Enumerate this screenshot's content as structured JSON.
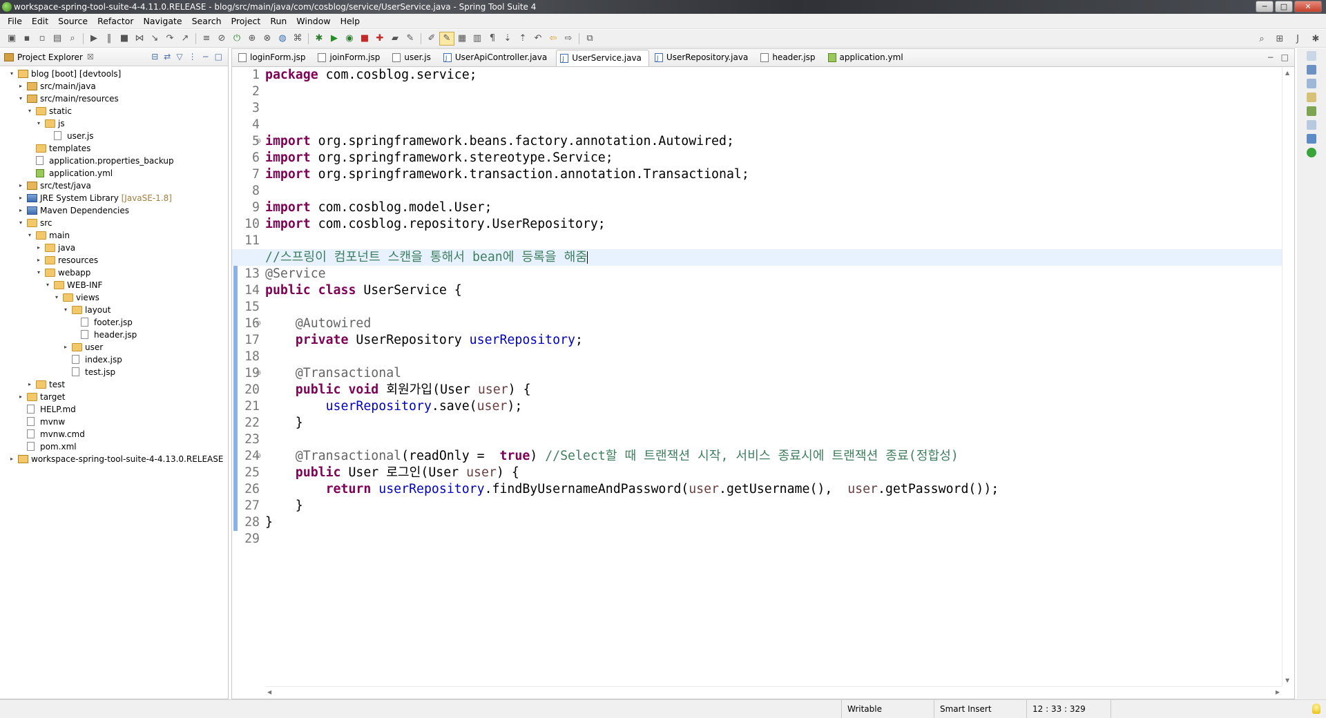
{
  "window": {
    "title": "workspace-spring-tool-suite-4-4.11.0.RELEASE - blog/src/main/java/com/cosblog/service/UserService.java - Spring Tool Suite 4",
    "controls": [
      "─",
      "□",
      "✕"
    ]
  },
  "menu": [
    "File",
    "Edit",
    "Source",
    "Refactor",
    "Navigate",
    "Search",
    "Project",
    "Run",
    "Window",
    "Help"
  ],
  "explorer": {
    "title": "Project Explorer",
    "close": "☒",
    "tree": [
      {
        "label": "blog [boot] [devtools]",
        "icon": "project-icon",
        "depth": 0,
        "twisty": "▾"
      },
      {
        "label": "src/main/java",
        "icon": "source-folder-icon",
        "depth": 1,
        "twisty": "▸"
      },
      {
        "label": "src/main/resources",
        "icon": "source-folder-icon",
        "depth": 1,
        "twisty": "▾"
      },
      {
        "label": "static",
        "icon": "folder-icon",
        "depth": 2,
        "twisty": "▾"
      },
      {
        "label": "js",
        "icon": "folder-icon",
        "depth": 3,
        "twisty": "▾"
      },
      {
        "label": "user.js",
        "icon": "file-icon",
        "depth": 4,
        "twisty": ""
      },
      {
        "label": "templates",
        "icon": "folder-icon",
        "depth": 2,
        "twisty": ""
      },
      {
        "label": "application.properties_backup",
        "icon": "file-icon",
        "depth": 2,
        "twisty": ""
      },
      {
        "label": "application.yml",
        "icon": "yml-file-icon",
        "depth": 2,
        "twisty": ""
      },
      {
        "label": "src/test/java",
        "icon": "source-folder-icon",
        "depth": 1,
        "twisty": "▸"
      },
      {
        "label": "JRE System Library",
        "suffix": "[JavaSE-1.8]",
        "icon": "library-icon",
        "depth": 1,
        "twisty": "▸"
      },
      {
        "label": "Maven Dependencies",
        "icon": "library-icon",
        "depth": 1,
        "twisty": "▸"
      },
      {
        "label": "src",
        "icon": "folder-icon",
        "depth": 1,
        "twisty": "▾"
      },
      {
        "label": "main",
        "icon": "folder-icon",
        "depth": 2,
        "twisty": "▾"
      },
      {
        "label": "java",
        "icon": "folder-icon",
        "depth": 3,
        "twisty": "▸"
      },
      {
        "label": "resources",
        "icon": "folder-icon",
        "depth": 3,
        "twisty": "▸"
      },
      {
        "label": "webapp",
        "icon": "folder-icon",
        "depth": 3,
        "twisty": "▾"
      },
      {
        "label": "WEB-INF",
        "icon": "folder-icon",
        "depth": 4,
        "twisty": "▾"
      },
      {
        "label": "views",
        "icon": "folder-icon",
        "depth": 5,
        "twisty": "▾"
      },
      {
        "label": "layout",
        "icon": "folder-icon",
        "depth": 6,
        "twisty": "▾"
      },
      {
        "label": "footer.jsp",
        "icon": "file-icon",
        "depth": 7,
        "twisty": ""
      },
      {
        "label": "header.jsp",
        "icon": "file-icon",
        "depth": 7,
        "twisty": ""
      },
      {
        "label": "user",
        "icon": "folder-icon",
        "depth": 6,
        "twisty": "▸"
      },
      {
        "label": "index.jsp",
        "icon": "file-icon",
        "depth": 6,
        "twisty": ""
      },
      {
        "label": "test.jsp",
        "icon": "file-icon",
        "depth": 6,
        "twisty": ""
      },
      {
        "label": "test",
        "icon": "folder-icon",
        "depth": 2,
        "twisty": "▸"
      },
      {
        "label": "target",
        "icon": "folder-icon",
        "depth": 1,
        "twisty": "▸"
      },
      {
        "label": "HELP.md",
        "icon": "file-icon",
        "depth": 1,
        "twisty": ""
      },
      {
        "label": "mvnw",
        "icon": "file-icon",
        "depth": 1,
        "twisty": ""
      },
      {
        "label": "mvnw.cmd",
        "icon": "file-icon",
        "depth": 1,
        "twisty": ""
      },
      {
        "label": "pom.xml",
        "icon": "file-icon",
        "depth": 1,
        "twisty": ""
      },
      {
        "label": "workspace-spring-tool-suite-4-4.13.0.RELEASE",
        "icon": "project-icon",
        "depth": 0,
        "twisty": "▸"
      }
    ]
  },
  "editor": {
    "tabs": [
      {
        "label": "loginForm.jsp",
        "icon": "jsp-file-icon",
        "active": false
      },
      {
        "label": "joinForm.jsp",
        "icon": "jsp-file-icon",
        "active": false
      },
      {
        "label": "user.js",
        "icon": "js-file-icon",
        "active": false
      },
      {
        "label": "UserApiController.java",
        "icon": "java-file-icon",
        "active": false
      },
      {
        "label": "UserService.java",
        "icon": "java-file-icon",
        "active": true
      },
      {
        "label": "UserRepository.java",
        "icon": "java-file-icon",
        "active": false
      },
      {
        "label": "header.jsp",
        "icon": "jsp-file-icon",
        "active": false
      },
      {
        "label": "application.yml",
        "icon": "yml-file-icon",
        "active": false
      }
    ],
    "current_line": 12,
    "fold_lines": [
      5,
      16,
      19,
      24
    ],
    "lines": [
      [
        [
          "kw",
          "package"
        ],
        [
          "",
          "com.cosblog.service;"
        ]
      ],
      [],
      [],
      [],
      [
        [
          "kw",
          "import"
        ],
        [
          "",
          "org.springframework.beans.factory.annotation.Autowired;"
        ]
      ],
      [
        [
          "kw",
          "import"
        ],
        [
          "",
          "org.springframework.stereotype.Service;"
        ]
      ],
      [
        [
          "kw",
          "import"
        ],
        [
          "",
          "org.springframework.transaction.annotation.Transactional;"
        ]
      ],
      [],
      [
        [
          "kw",
          "import"
        ],
        [
          "",
          "com.cosblog.model.User;"
        ]
      ],
      [
        [
          "kw",
          "import"
        ],
        [
          "",
          "com.cosblog.repository.UserRepository;"
        ]
      ],
      [],
      [
        [
          "cmt",
          "//스프링이 컴포넌트 스캔을 통해서 bean에 등록을 해줌"
        ]
      ],
      [
        [
          "ann",
          "@Service"
        ]
      ],
      [
        [
          "kw",
          "public"
        ],
        [
          "kw",
          "class"
        ],
        [
          "",
          "UserService {"
        ]
      ],
      [],
      [
        [
          "ann",
          "    @Autowired"
        ]
      ],
      [
        [
          "kw",
          "    private"
        ],
        [
          "",
          "UserRepository"
        ],
        [
          "fld",
          "userRepository"
        ],
        [
          "",
          ";"
        ]
      ],
      [],
      [
        [
          "ann",
          "    @Transactional"
        ]
      ],
      [
        [
          "kw",
          "    public"
        ],
        [
          "kw",
          "void"
        ],
        [
          "",
          "회원가입(User"
        ],
        [
          "var",
          "user"
        ],
        [
          "",
          ") {"
        ]
      ],
      [
        [
          "fld",
          "        userRepository"
        ],
        [
          "",
          ".save("
        ],
        [
          "var",
          "user"
        ],
        [
          "",
          ");"
        ]
      ],
      [
        [
          "",
          "    }"
        ]
      ],
      [],
      [
        [
          "ann",
          "    @Transactional"
        ],
        [
          "",
          "(readOnly = "
        ],
        [
          "kw",
          "true"
        ],
        [
          "",
          ")"
        ],
        [
          "cmt",
          "//Select할 때 트랜잭션 시작, 서비스 종료시에 트랜잭션 종료(정합성)"
        ]
      ],
      [
        [
          "kw",
          "    public"
        ],
        [
          "",
          "User 로그인(User"
        ],
        [
          "var",
          "user"
        ],
        [
          "",
          ") {"
        ]
      ],
      [
        [
          "kw",
          "        return"
        ],
        [
          "fld",
          "userRepository"
        ],
        [
          "",
          ".findByUsernameAndPassword("
        ],
        [
          "var",
          "user"
        ],
        [
          "",
          ".getUsername(), "
        ],
        [
          "var",
          "user"
        ],
        [
          "",
          ".getPassword());"
        ]
      ],
      [
        [
          "",
          "    }"
        ]
      ],
      [
        [
          "",
          "}"
        ]
      ],
      []
    ]
  },
  "status": {
    "mode": "Writable",
    "insert": "Smart Insert",
    "position": "12 : 33 : 329"
  }
}
